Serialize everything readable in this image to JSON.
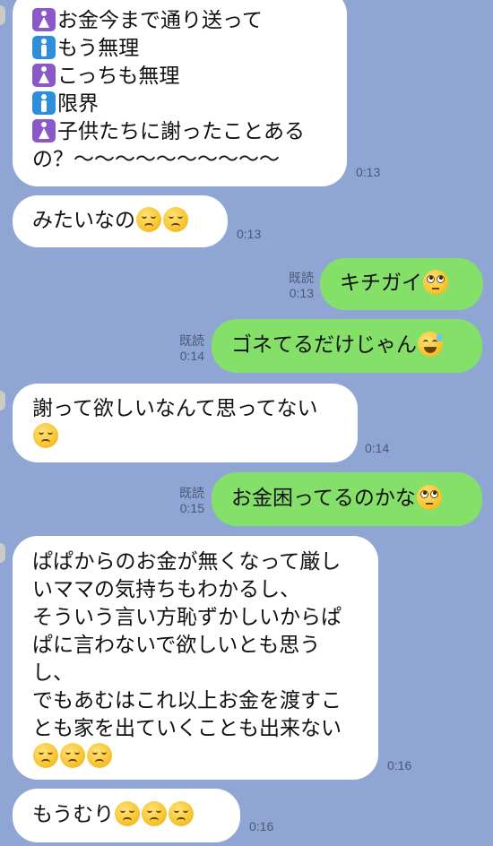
{
  "messages": [
    {
      "id": "m1",
      "lines": [
        "お金今まで通り送って",
        "もう無理",
        "こっちも無理",
        "限界",
        "子供たちに謝ったことある",
        "の？〜〜〜〜〜〜〜〜〜〜"
      ],
      "icons": [
        "womens-room-icon",
        "mens-room-icon",
        "womens-room-icon",
        "mens-room-icon",
        "womens-room-icon",
        ""
      ],
      "time": "0:13"
    },
    {
      "id": "m2",
      "text": "みたいなの",
      "time": "0:13"
    },
    {
      "id": "m3",
      "text": "キチガイ",
      "read": "既読",
      "time": "0:13"
    },
    {
      "id": "m4",
      "text": "ゴネてるだけじゃん",
      "read": "既読",
      "time": "0:14"
    },
    {
      "id": "m5",
      "text": "謝って欲しいなんて思ってない",
      "time": "0:14"
    },
    {
      "id": "m6",
      "text": "お金困ってるのかな",
      "read": "既読",
      "time": "0:15"
    },
    {
      "id": "m7",
      "lines": [
        "ぱぱからのお金が無くなって厳し",
        "いママの気持ちもわかるし、",
        "そういう言い方恥ずかしいからぱ",
        "ぱに言わないで欲しいとも思う",
        "し、",
        "でもあむはこれ以上お金を渡すこ",
        "とも家を出ていくことも出来ない"
      ],
      "time": "0:16"
    },
    {
      "id": "m8",
      "text": "もうむり",
      "time": "0:16"
    }
  ],
  "emoji_names": {
    "disappointed": "disappointed-face-icon",
    "rolling": "face-with-rolling-eyes-icon",
    "sweat": "grinning-face-with-sweat-icon"
  },
  "colors": {
    "background": "#8fa6d4",
    "incoming_bubble": "#ffffff",
    "outgoing_bubble": "#84e068",
    "meta_text": "#4b5875"
  }
}
